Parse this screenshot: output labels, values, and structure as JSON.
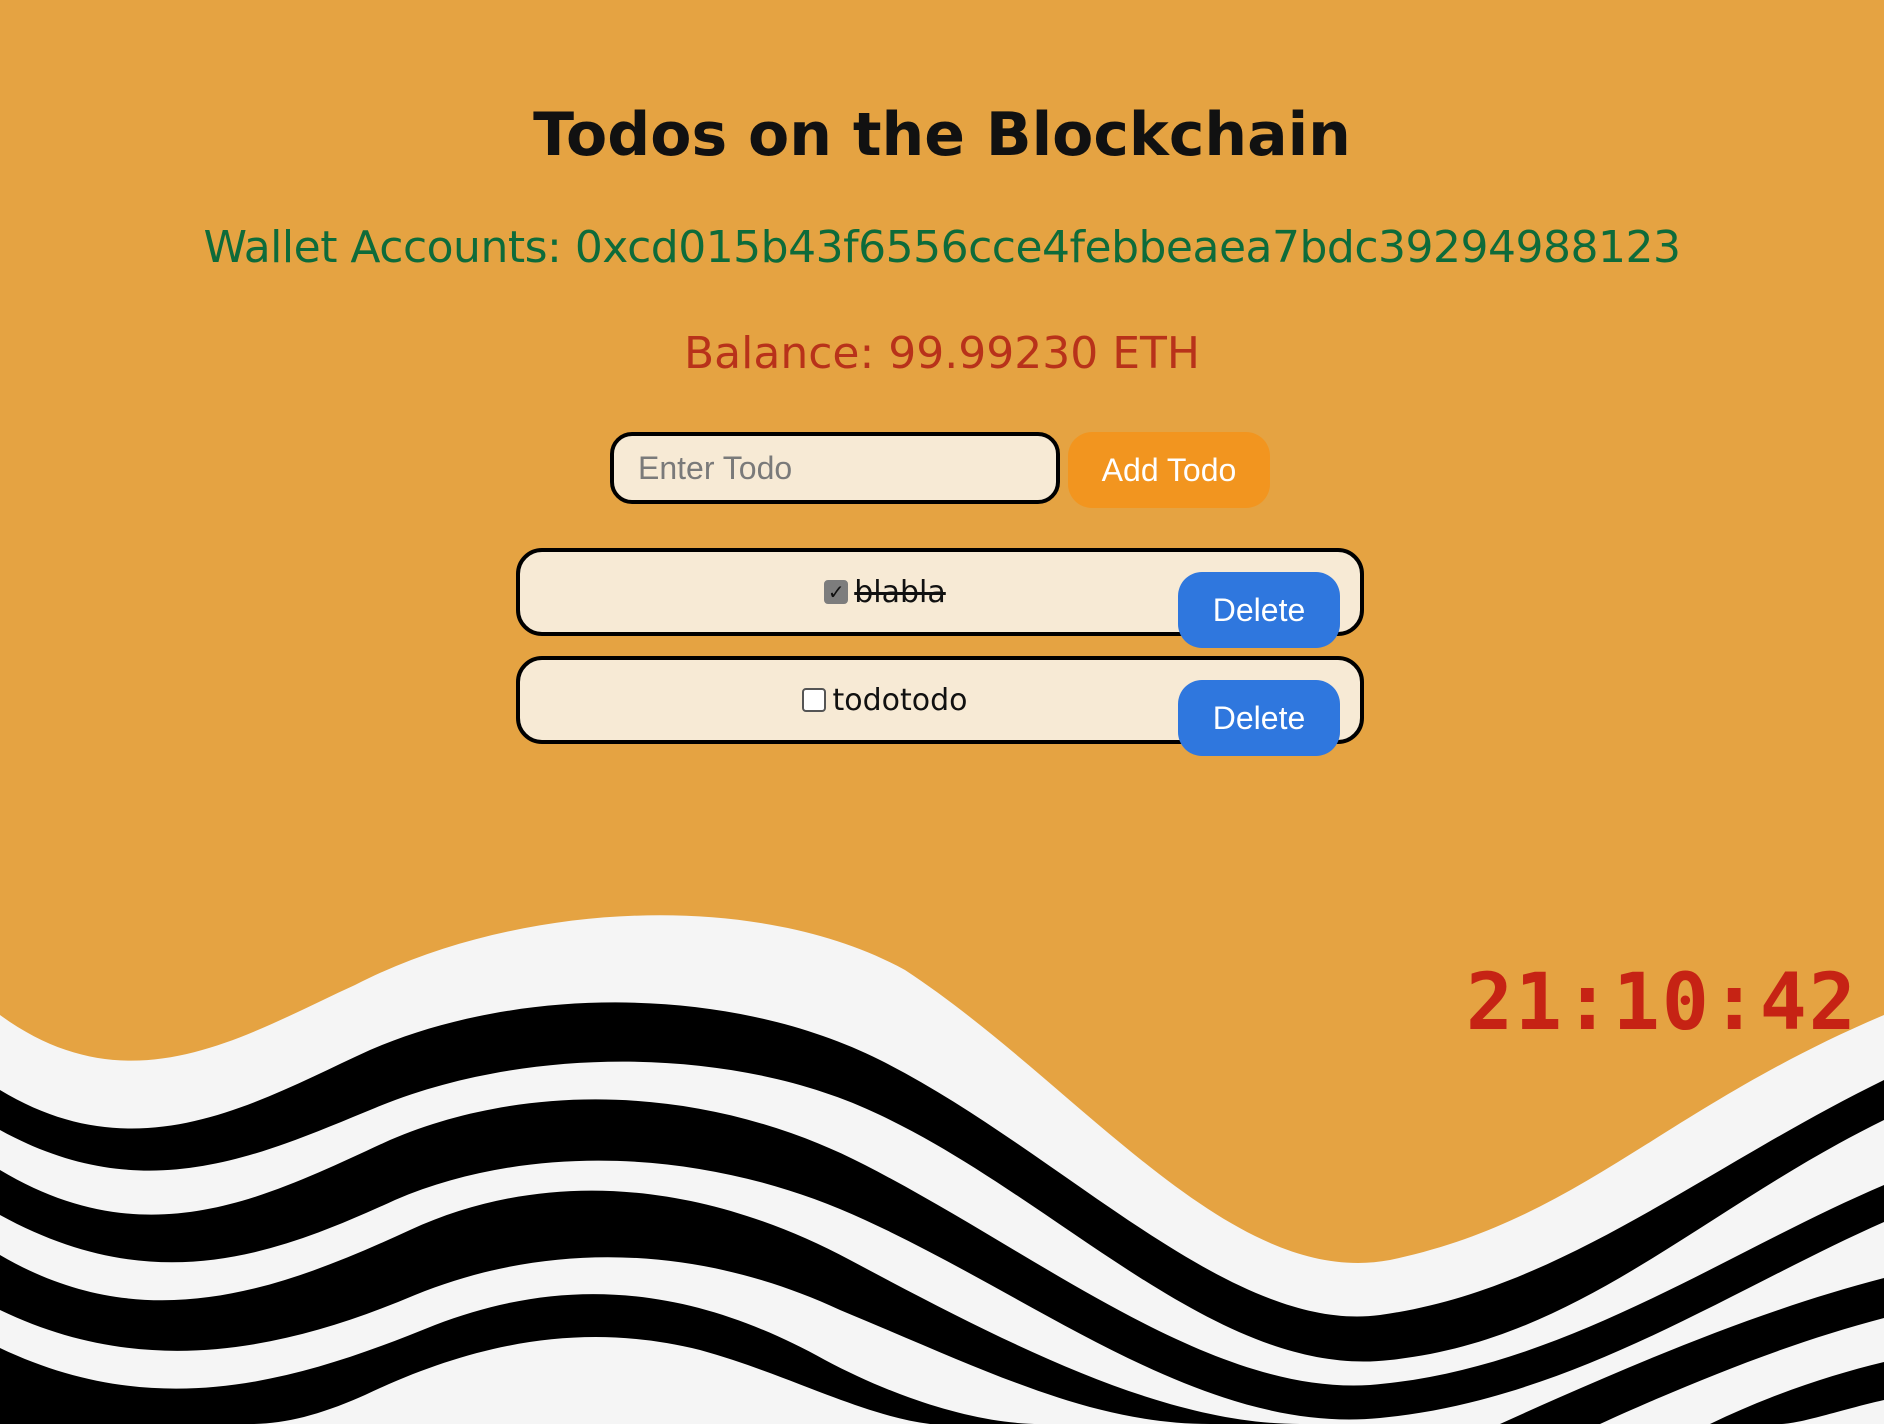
{
  "page": {
    "title": "Todos on the Blockchain",
    "wallet_text": "Wallet Accounts: 0xcd015b43f6556cce4febbeaea7bdc39294988123",
    "balance_text": "Balance: 99.99230 ETH",
    "clock": "21:10:42"
  },
  "form": {
    "input_placeholder": "Enter Todo",
    "input_value": "",
    "add_label": "Add Todo"
  },
  "todos": [
    {
      "text": "blabla",
      "completed": true,
      "delete_label": "Delete"
    },
    {
      "text": "todotodo",
      "completed": false,
      "delete_label": "Delete"
    }
  ],
  "colors": {
    "background": "#e5a342",
    "wallet": "#0e6b3a",
    "balance": "#b8321a",
    "add_button": "#f2951f",
    "delete_button": "#2f77de",
    "clock": "#c62314"
  }
}
